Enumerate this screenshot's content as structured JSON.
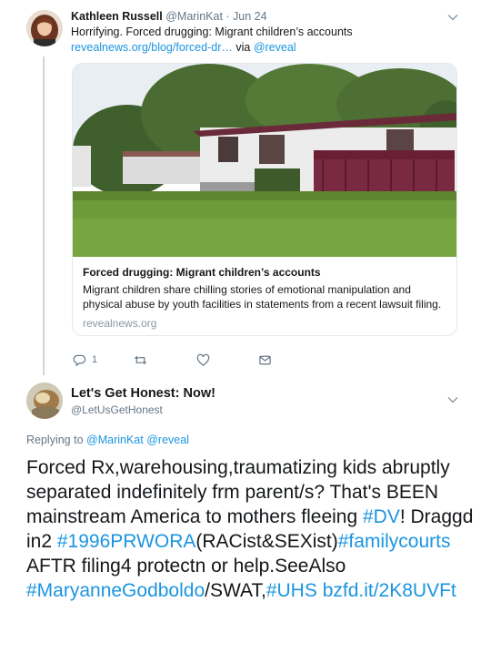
{
  "tweet1": {
    "author_name": "Kathleen Russell",
    "author_handle": "@MarinKat",
    "separator": " · ",
    "date": "Jun 24",
    "text": "Horrifying. Forced drugging: Migrant children’s accounts",
    "link_text": "revealnews.org/blog/forced-dr…",
    "via_text": " via ",
    "via_handle": "@reveal",
    "card": {
      "title": "Forced drugging: Migrant children’s accounts",
      "description": "Migrant children share chilling stories of emotional manipulation and physical abuse by youth facilities in statements from a recent lawsuit filing.",
      "domain": "revealnews.org"
    },
    "actions": {
      "reply_icon": "reply-icon",
      "reply_count": "1",
      "retweet_icon": "retweet-icon",
      "like_icon": "heart-icon",
      "dm_icon": "envelope-icon"
    }
  },
  "tweet2": {
    "author_name": "Let's Get Honest: Now!",
    "author_handle": "@LetUsGetHonest",
    "replying_prefix": "Replying to ",
    "replying_handle_1": "@MarinKat",
    "replying_space": " ",
    "replying_handle_2": "@reveal",
    "segments": [
      {
        "text": "Forced Rx,warehousing,traumatizing kids abruptly separated indefinitely frm parent/s? That's BEEN mainstream America to mothers fleeing ",
        "tag": false
      },
      {
        "text": "#DV",
        "tag": true
      },
      {
        "text": "! Draggd in2 ",
        "tag": false
      },
      {
        "text": "#1996PRWORA",
        "tag": true
      },
      {
        "text": "(RACist&SEXist)",
        "tag": false
      },
      {
        "text": "#familycourts",
        "tag": true
      },
      {
        "text": " AFTR filing4 protectn or help.SeeAlso ",
        "tag": false
      },
      {
        "text": "#MaryanneGodboldo",
        "tag": true
      },
      {
        "text": "/SWAT,",
        "tag": false
      },
      {
        "text": "#UHS",
        "tag": true
      },
      {
        "text": " ",
        "tag": false
      },
      {
        "text": "bzfd.it/2K8UVFt",
        "tag": true
      }
    ]
  },
  "colors": {
    "link": "#1b95e0",
    "secondary_text": "#657786",
    "primary_text": "#14171a",
    "border": "#e1e8ed"
  }
}
